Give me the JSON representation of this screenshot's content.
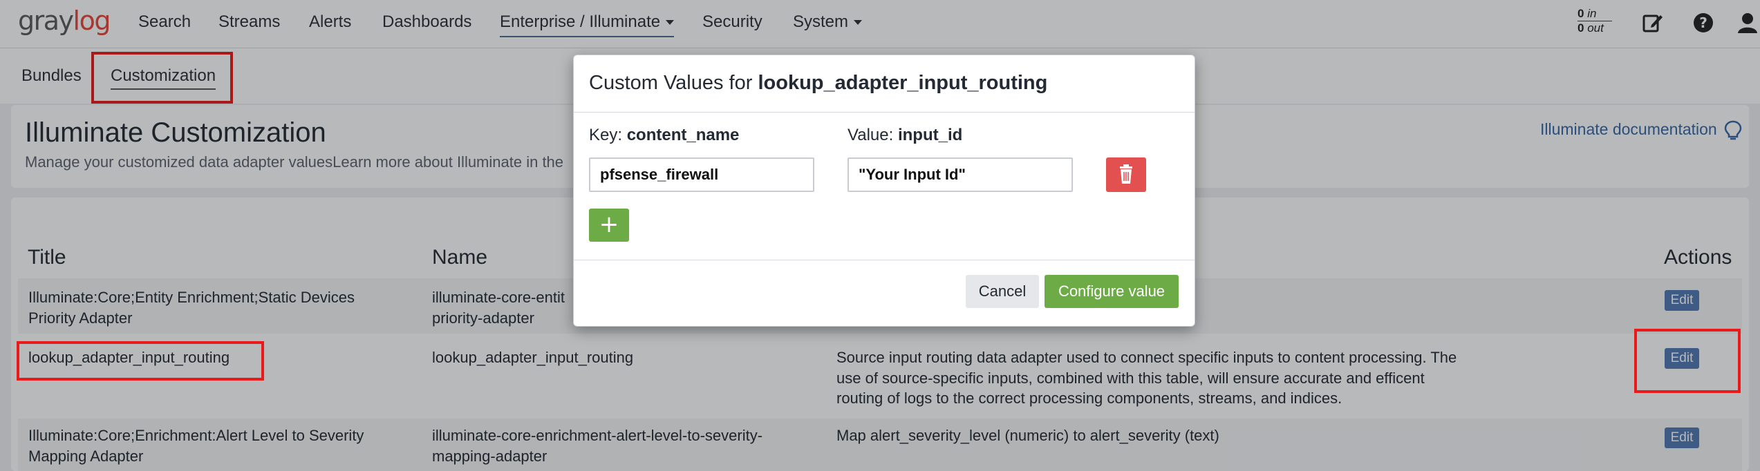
{
  "brand": {
    "logo_left": "gray",
    "logo_right": "log",
    "accent": "#e5453c"
  },
  "nav": {
    "items": [
      {
        "label": "Search"
      },
      {
        "label": "Streams"
      },
      {
        "label": "Alerts"
      },
      {
        "label": "Dashboards"
      },
      {
        "label": "Enterprise / Illuminate"
      },
      {
        "label": "Security"
      },
      {
        "label": "System"
      }
    ],
    "throughput_in_value": "0",
    "throughput_in_label": "in",
    "throughput_out_value": "0",
    "throughput_out_label": "out",
    "icons": [
      "edit-icon",
      "help-icon",
      "user-icon"
    ]
  },
  "subnav": {
    "tabs": [
      {
        "label": "Bundles"
      },
      {
        "label": "Customization"
      }
    ]
  },
  "page": {
    "title": "Illuminate Customization",
    "subtitle": "Manage your customized data adapter valuesLearn more about Illuminate in the",
    "doc_link": "Illuminate documentation"
  },
  "table": {
    "headers": {
      "title": "Title",
      "name": "Name",
      "actions": "Actions"
    },
    "rows": [
      {
        "title_line1": "Illuminate:Core;Entity Enrichment;Static Devices",
        "title_line2": "Priority Adapter",
        "name_line1": "illuminate-core-entit",
        "name_line2": "priority-adapter",
        "description": "",
        "action": "Edit"
      },
      {
        "title_line1": "lookup_adapter_input_routing",
        "title_line2": "",
        "name_line1": "lookup_adapter_input_routing",
        "name_line2": "",
        "desc_line1": "Source input routing data adapter used to connect specific inputs to content processing. The",
        "desc_line2": "use of source-specific inputs, combined with this table, will ensure accurate and efficent",
        "desc_line3": "routing of logs to the correct processing components, streams, and indices.",
        "action": "Edit"
      },
      {
        "title_line1": "Illuminate:Core;Enrichment:Alert Level to Severity",
        "title_line2": "Mapping Adapter",
        "name_line1": "illuminate-core-enrichment-alert-level-to-severity-",
        "name_line2": "mapping-adapter",
        "desc_line1": "Map alert_severity_level (numeric) to alert_severity (text)",
        "action": "Edit"
      }
    ]
  },
  "modal": {
    "title_prefix": "Custom Values for",
    "title_name": "lookup_adapter_input_routing",
    "key_label": "Key:",
    "key_name": "content_name",
    "value_label": "Value:",
    "value_name": "input_id",
    "key_value": "pfsense_firewall",
    "value_value": "\"Your Input Id\"",
    "add_label": "+",
    "cancel_label": "Cancel",
    "configure_label": "Configure value"
  },
  "colors": {
    "primary_blue": "#4f79b3",
    "success_green": "#6cab46",
    "danger_red": "#e25050",
    "highlight_red": "#ea1a1a"
  }
}
